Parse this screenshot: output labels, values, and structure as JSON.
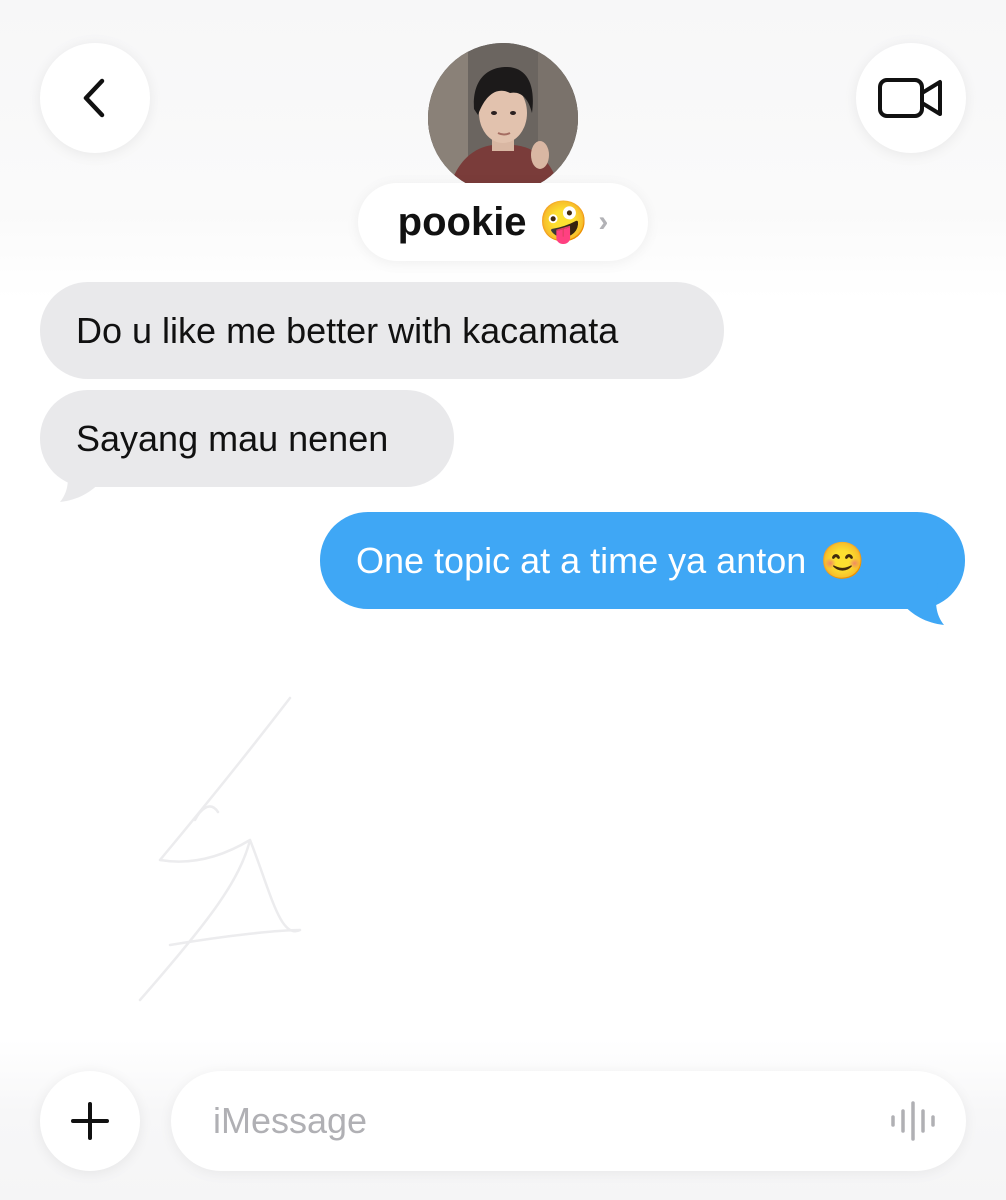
{
  "header": {
    "back_icon": "chevron-left-icon",
    "video_icon": "video-camera-icon",
    "contact_name": "pookie",
    "contact_emoji": "🤪",
    "chevron": "›"
  },
  "messages": [
    {
      "direction": "incoming",
      "text": "Do u like me better with kacamata"
    },
    {
      "direction": "incoming",
      "text": "Sayang mau nenen"
    },
    {
      "direction": "outgoing",
      "text": "One topic at a time ya anton",
      "emoji": "😊"
    }
  ],
  "composer": {
    "plus_icon": "plus-icon",
    "placeholder": "iMessage",
    "value": "",
    "audio_icon": "audio-waveform-icon"
  },
  "colors": {
    "incoming_bubble": "#e9e9eb",
    "outgoing_bubble": "#3fa7f5",
    "background": "#ffffff"
  }
}
